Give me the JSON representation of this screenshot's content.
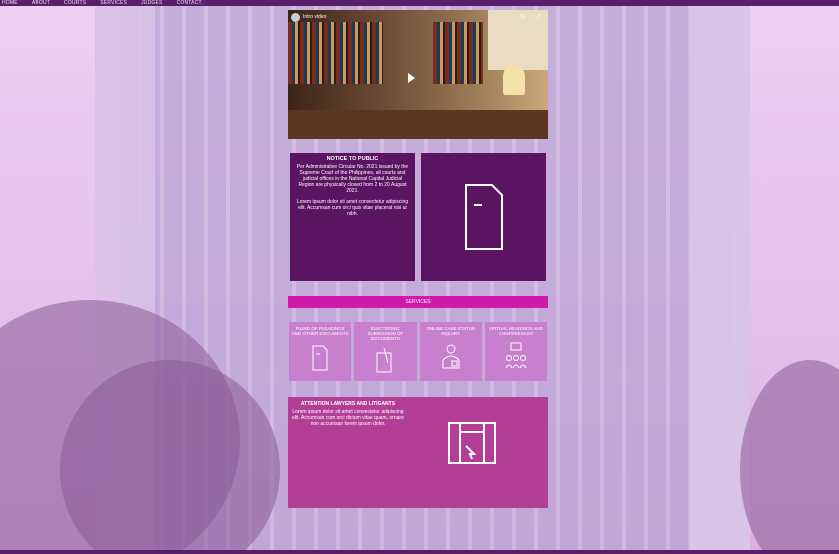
{
  "nav": [
    "HOME",
    "ABOUT",
    "COURTS",
    "SERVICES",
    "JUDGES",
    "CONTACT"
  ],
  "video": {
    "title": "Intro video"
  },
  "notice": {
    "heading": "NOTICE TO PUBLIC",
    "body": "Per Administrative Circular No. 2021 issued by the Supreme Court of the Philippines, all courts and judicial offices in the National Capital Judicial Region are physically closed from 2 to 20 August 2021.",
    "body2": "Lorem ipsum dolor sit amet consectetur adipiscing elit. Accumsan cum orci quis vitae placerat nisi ut nibh."
  },
  "band": {
    "label": "SERVICES"
  },
  "services": [
    {
      "label": "FILING OF PLEADINGS AND OTHER DOCUMENTS",
      "icon": "document-icon"
    },
    {
      "label": "ELECTRONIC SUBMISSION OF DOCUMENTS",
      "icon": "pen-paper-icon"
    },
    {
      "label": "ONLINE CASE STATUS INQUIRY",
      "icon": "person-badge-icon"
    },
    {
      "label": "VIRTUAL HEARINGS AND CONFERENCES",
      "icon": "meeting-icon"
    }
  ],
  "feature": {
    "heading": "ATTENTION LAWYERS AND LITIGANTS",
    "body": "Lorem ipsum dolor sit amet consectetur adipiscing elit. Accumsan cum orci dictum vitae quam, ornare non accumsan lorem ipsum dolor."
  }
}
